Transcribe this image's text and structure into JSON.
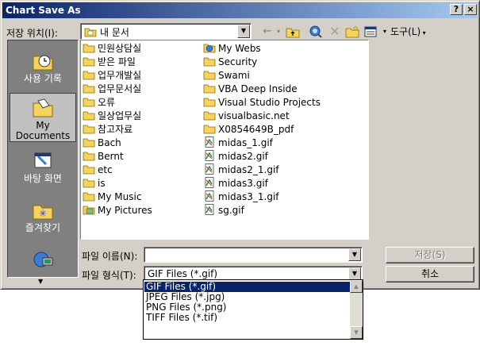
{
  "window": {
    "title": "Chart Save As",
    "help_button": "?",
    "close_button": "×"
  },
  "location": {
    "label": "저장 위치(I):",
    "value": "내 문서"
  },
  "toolbar": {
    "tools_label": "도구(L)"
  },
  "places": [
    {
      "label": "사용 기록",
      "icon": "history-icon"
    },
    {
      "label": "My Documents",
      "icon": "my-documents-icon"
    },
    {
      "label": "바탕 화면",
      "icon": "desktop-icon"
    },
    {
      "label": "즐겨찾기",
      "icon": "favorites-icon"
    },
    {
      "label": "",
      "icon": "network-places-icon"
    }
  ],
  "files_col1": [
    {
      "name": "민원상담실",
      "type": "folder"
    },
    {
      "name": "받은 파일",
      "type": "folder"
    },
    {
      "name": "업무개발실",
      "type": "folder"
    },
    {
      "name": "업무문서실",
      "type": "folder"
    },
    {
      "name": "오류",
      "type": "folder"
    },
    {
      "name": "일상업무실",
      "type": "folder"
    },
    {
      "name": "참고자료",
      "type": "folder"
    },
    {
      "name": "Bach",
      "type": "folder"
    },
    {
      "name": "Bernt",
      "type": "folder"
    },
    {
      "name": "etc",
      "type": "folder"
    },
    {
      "name": "is",
      "type": "folder"
    },
    {
      "name": "My Music",
      "type": "folder"
    },
    {
      "name": "My Pictures",
      "type": "pictures-folder"
    }
  ],
  "files_col2": [
    {
      "name": "My Webs",
      "type": "web-folder"
    },
    {
      "name": "Security",
      "type": "folder"
    },
    {
      "name": "Swami",
      "type": "folder"
    },
    {
      "name": "VBA Deep Inside",
      "type": "folder"
    },
    {
      "name": "Visual Studio Projects",
      "type": "folder"
    },
    {
      "name": "visualbasic.net",
      "type": "folder"
    },
    {
      "name": "X0854649B_pdf",
      "type": "folder"
    },
    {
      "name": "midas_1.gif",
      "type": "gif"
    },
    {
      "name": "midas2.gif",
      "type": "gif"
    },
    {
      "name": "midas2_1.gif",
      "type": "gif"
    },
    {
      "name": "midas3.gif",
      "type": "gif"
    },
    {
      "name": "midas3_1.gif",
      "type": "gif"
    },
    {
      "name": "sg.gif",
      "type": "gif"
    }
  ],
  "filename": {
    "label": "파일 이름(N):",
    "value": ""
  },
  "filetype": {
    "label": "파일 형식(T):",
    "value": "GIF Files (*.gif)"
  },
  "buttons": {
    "save": "저장(S)",
    "cancel": "취소"
  },
  "filetype_options": [
    "GIF Files (*.gif)",
    "JPEG Files (*.jpg)",
    "PNG Files (*.png)",
    "TIFF Files (*.tif)"
  ],
  "colors": {
    "title_start": "#0a246a",
    "title_end": "#a6caf0",
    "face": "#d4d0c8",
    "folder": "#f4d35e",
    "selection": "#0a246a"
  }
}
